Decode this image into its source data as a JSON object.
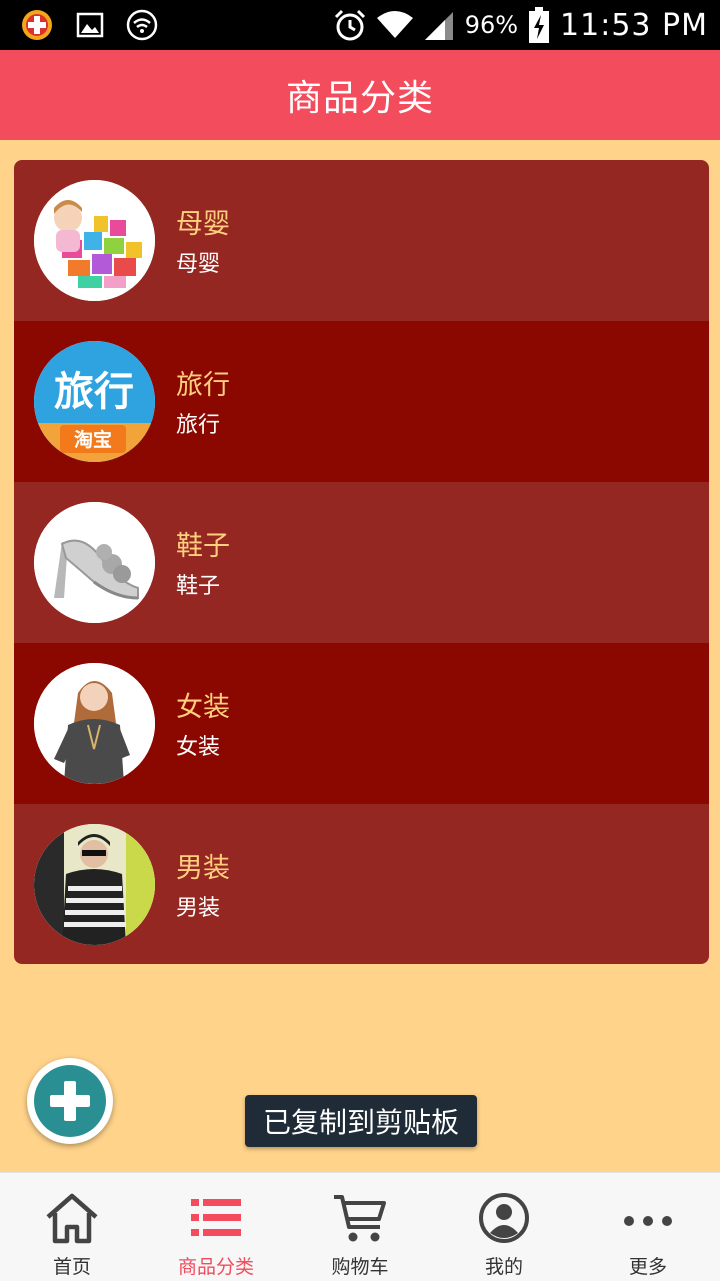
{
  "status_bar": {
    "battery_percent": "96%",
    "time": "11:53 PM"
  },
  "header": {
    "title": "商品分类"
  },
  "categories": [
    {
      "name": "母婴",
      "desc": "母婴",
      "thumb": "toy-blocks-child"
    },
    {
      "name": "旅行",
      "desc": "旅行",
      "thumb": "taobao-travel-logo",
      "logo_text": "旅行",
      "logo_sub": "淘宝"
    },
    {
      "name": "鞋子",
      "desc": "鞋子",
      "thumb": "silver-high-heel"
    },
    {
      "name": "女装",
      "desc": "女装",
      "thumb": "woman-sweater"
    },
    {
      "name": "男装",
      "desc": "男装",
      "thumb": "man-striped-shirt"
    }
  ],
  "fab": {
    "icon": "plus-icon"
  },
  "toast": {
    "text": "已复制到剪贴板"
  },
  "bottom_nav": {
    "items": [
      {
        "label": "首页",
        "icon": "home-icon"
      },
      {
        "label": "商品分类",
        "icon": "list-icon",
        "active": true
      },
      {
        "label": "购物车",
        "icon": "cart-icon"
      },
      {
        "label": "我的",
        "icon": "user-icon"
      },
      {
        "label": "更多",
        "icon": "more-icon"
      }
    ]
  },
  "colors": {
    "accent": "#f24c5d",
    "background": "#ffd38a",
    "row_a": "#952722",
    "row_b": "#8a0800",
    "category_name": "#ffcf7e"
  }
}
